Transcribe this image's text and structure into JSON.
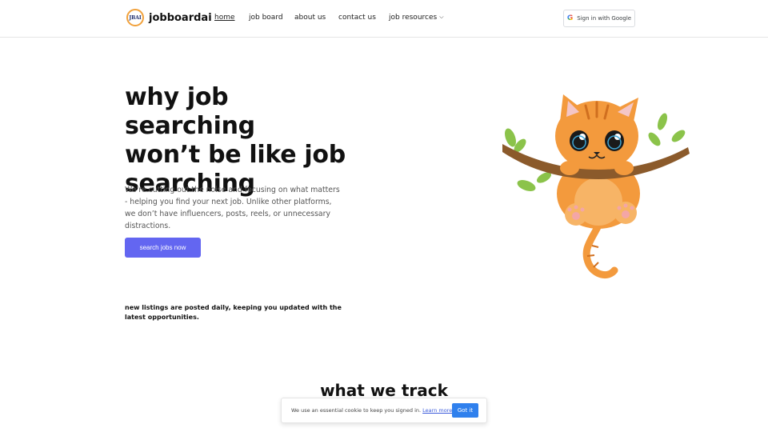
{
  "brand": {
    "name": "jobboardai",
    "logo_text": "JBAI"
  },
  "nav": {
    "items": [
      {
        "label": "home",
        "active": true
      },
      {
        "label": "job board"
      },
      {
        "label": "about us"
      },
      {
        "label": "contact us"
      },
      {
        "label": "job resources",
        "has_dropdown": true
      }
    ]
  },
  "auth": {
    "google_label": "Sign in with Google",
    "google_icon": "google-g-icon"
  },
  "hero": {
    "title_lines": [
      "why job searching",
      "won’t be like job",
      "searching"
    ],
    "description": "We’re cutting out the noise and focusing on what matters - helping you find your next job. Unlike other platforms, we don’t have influencers, posts, reels, or unnecessary distractions.",
    "cta_label": "search jobs now",
    "note": "new listings are posted daily, keeping you updated with the latest opportunities.",
    "illustration": "orange-kitten-on-branch"
  },
  "section": {
    "title": "what we track"
  },
  "cookie": {
    "text": "We use an essential cookie to keep you signed in.",
    "link_label": "Learn more",
    "button_label": "Got it"
  },
  "colors": {
    "accent": "#6366f1",
    "cookie_button": "#2f80ed",
    "cat_orange": "#f39a3d"
  }
}
